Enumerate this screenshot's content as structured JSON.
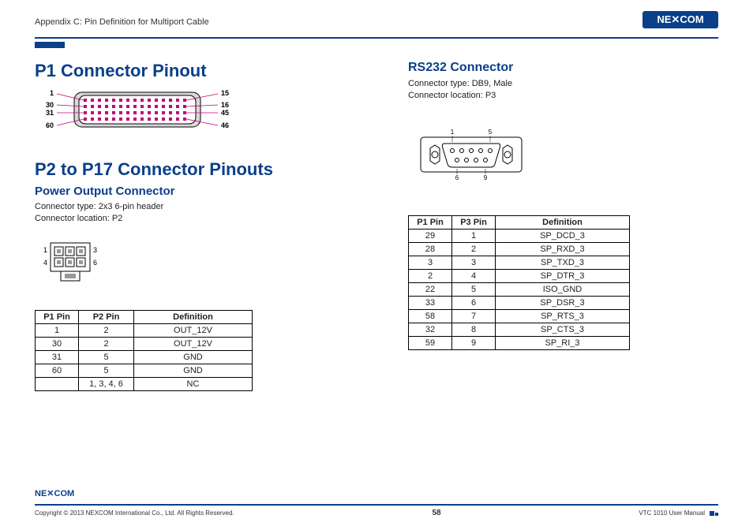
{
  "header": {
    "appendix": "Appendix C: Pin Definition for Multiport Cable",
    "brand": "NEXCOM"
  },
  "left": {
    "h1a": "P1 Connector Pinout",
    "p1_labels": {
      "tl": "1",
      "tr": "15",
      "ml1": "30",
      "mr1": "16",
      "ml2": "31",
      "mr2": "45",
      "bl": "60",
      "br": "46"
    },
    "h1b": "P2 to P17 Connector Pinouts",
    "h2": "Power Output Connector",
    "type": "Connector type: 2x3 6-pin header",
    "loc": "Connector location: P2",
    "p2_labels": {
      "tl": "1",
      "tr": "3",
      "bl": "4",
      "br": "6"
    },
    "table": {
      "headers": [
        "P1 Pin",
        "P2 Pin",
        "Definition"
      ],
      "rows": [
        [
          "1",
          "2",
          "OUT_12V"
        ],
        [
          "30",
          "2",
          "OUT_12V"
        ],
        [
          "31",
          "5",
          "GND"
        ],
        [
          "60",
          "5",
          "GND"
        ],
        [
          "",
          "1, 3, 4, 6",
          "NC"
        ]
      ]
    }
  },
  "right": {
    "h2": "RS232 Connector",
    "type": "Connector type: DB9, Male",
    "loc": "Connector location: P3",
    "db9_labels": {
      "tl": "1",
      "tr": "5",
      "bl": "6",
      "br": "9"
    },
    "table": {
      "headers": [
        "P1 Pin",
        "P3 Pin",
        "Definition"
      ],
      "rows": [
        [
          "29",
          "1",
          "SP_DCD_3"
        ],
        [
          "28",
          "2",
          "SP_RXD_3"
        ],
        [
          "3",
          "3",
          "SP_TXD_3"
        ],
        [
          "2",
          "4",
          "SP_DTR_3"
        ],
        [
          "22",
          "5",
          "ISO_GND"
        ],
        [
          "33",
          "6",
          "SP_DSR_3"
        ],
        [
          "58",
          "7",
          "SP_RTS_3"
        ],
        [
          "32",
          "8",
          "SP_CTS_3"
        ],
        [
          "59",
          "9",
          "SP_RI_3"
        ]
      ]
    }
  },
  "footer": {
    "copyright": "Copyright © 2013 NEXCOM International Co., Ltd. All Rights Reserved.",
    "page": "58",
    "manual": "VTC 1010 User Manual"
  }
}
